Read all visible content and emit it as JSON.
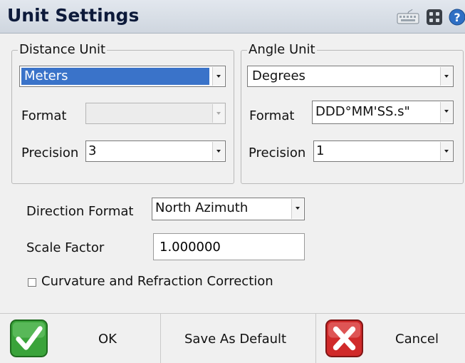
{
  "window": {
    "title": "Unit Settings"
  },
  "toolbar_icons": [
    "keyboard-icon",
    "grid-icon",
    "help-icon"
  ],
  "distance_unit": {
    "legend": "Distance Unit",
    "unit_value": "Meters",
    "format_label": "Format",
    "format_value": "",
    "precision_label": "Precision",
    "precision_value": "3"
  },
  "angle_unit": {
    "legend": "Angle Unit",
    "unit_value": "Degrees",
    "format_label": "Format",
    "format_value": "DDD°MM'SS.s\"",
    "precision_label": "Precision",
    "precision_value": "1"
  },
  "direction_format": {
    "label": "Direction Format",
    "value": "North Azimuth"
  },
  "scale_factor": {
    "label": "Scale Factor",
    "value": "1.000000"
  },
  "curvature": {
    "label": "Curvature and Refraction Correction",
    "checked": false
  },
  "buttons": {
    "ok": "OK",
    "save_default": "Save As Default",
    "cancel": "Cancel"
  },
  "colors": {
    "accent_selection": "#3a73c9",
    "ok_green": "#3aa33a",
    "cancel_red": "#d02a2a"
  }
}
